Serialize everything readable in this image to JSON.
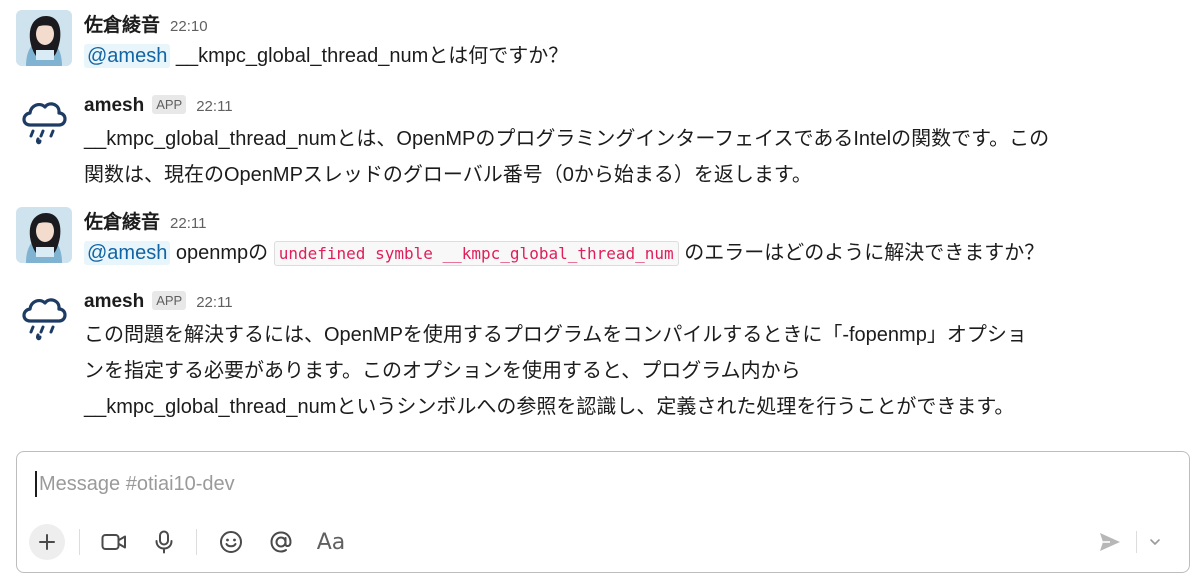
{
  "messages": [
    {
      "author": "佐倉綾音",
      "time": "22:10",
      "avatar": "user-photo-avatar",
      "mention": "@amesh",
      "text": " __kmpc_global_thread_numとは何ですか？"
    },
    {
      "author": "amesh",
      "badge": "APP",
      "time": "22:11",
      "avatar": "rain-cloud-icon",
      "line1": "__kmpc_global_thread_numとは、OpenMPのプログラミングインターフェイスであるIntelの関数です。この",
      "line2": "関数は、現在のOpenMPスレッドのグローバル番号（0から始まる）を返します。"
    },
    {
      "author": "佐倉綾音",
      "time": "22:11",
      "avatar": "user-photo-avatar",
      "mention": "@amesh",
      "text_before": " openmpの ",
      "code": "undefined symble __kmpc_global_thread_num",
      "text_after": " のエラーはどのように解決できますか？"
    },
    {
      "author": "amesh",
      "badge": "APP",
      "time": "22:11",
      "avatar": "rain-cloud-icon",
      "line1": "この問題を解決するには、OpenMPを使用するプログラムをコンパイルするときに「-fopenmp」オプショ",
      "line2": "ンを指定する必要があります。このオプションを使用すると、プログラム内から",
      "line3": "__kmpc_global_thread_numというシンボルへの参照を認識し、定義された処理を行うことができます。"
    }
  ],
  "composer": {
    "placeholder": "Message #otiai10-dev",
    "aa_label": "Aa",
    "icons": [
      "plus-icon",
      "video-icon",
      "microphone-icon",
      "emoji-icon",
      "at-icon",
      "format-icon",
      "send-icon",
      "chevron-down-icon"
    ]
  },
  "colors": {
    "mention_bg": "#e8f5fa",
    "mention_text": "#1264a3",
    "code_text": "#e01e5a",
    "cloud": "#1d3b63",
    "rain": "#1d3b63"
  }
}
